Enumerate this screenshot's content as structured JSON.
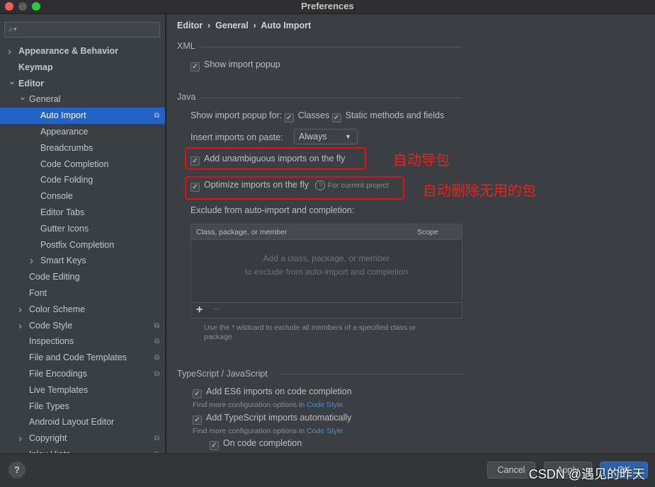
{
  "window": {
    "title": "Preferences"
  },
  "sidebar": {
    "search_placeholder": "",
    "items": [
      {
        "label": "Appearance & Behavior",
        "level": 0,
        "arrow": "right",
        "bold": true
      },
      {
        "label": "Keymap",
        "level": 0,
        "bold": true
      },
      {
        "label": "Editor",
        "level": 0,
        "arrow": "down",
        "bold": true
      },
      {
        "label": "General",
        "level": 1,
        "arrow": "down"
      },
      {
        "label": "Auto Import",
        "level": 2,
        "selected": true,
        "copy_icon": true
      },
      {
        "label": "Appearance",
        "level": 2
      },
      {
        "label": "Breadcrumbs",
        "level": 2
      },
      {
        "label": "Code Completion",
        "level": 2
      },
      {
        "label": "Code Folding",
        "level": 2
      },
      {
        "label": "Console",
        "level": 2
      },
      {
        "label": "Editor Tabs",
        "level": 2
      },
      {
        "label": "Gutter Icons",
        "level": 2
      },
      {
        "label": "Postfix Completion",
        "level": 2
      },
      {
        "label": "Smart Keys",
        "level": 2,
        "arrow": "right"
      },
      {
        "label": "Code Editing",
        "level": 1
      },
      {
        "label": "Font",
        "level": 1
      },
      {
        "label": "Color Scheme",
        "level": 1,
        "arrow": "right"
      },
      {
        "label": "Code Style",
        "level": 1,
        "arrow": "right",
        "copy_icon": true
      },
      {
        "label": "Inspections",
        "level": 1,
        "copy_icon": true
      },
      {
        "label": "File and Code Templates",
        "level": 1,
        "copy_icon": true
      },
      {
        "label": "File Encodings",
        "level": 1,
        "copy_icon": true
      },
      {
        "label": "Live Templates",
        "level": 1
      },
      {
        "label": "File Types",
        "level": 1
      },
      {
        "label": "Android Layout Editor",
        "level": 1
      },
      {
        "label": "Copyright",
        "level": 1,
        "arrow": "right",
        "copy_icon": true
      },
      {
        "label": "Inlay Hints",
        "level": 1,
        "arrow": "right",
        "copy_icon": true
      }
    ]
  },
  "breadcrumb": [
    "Editor",
    "General",
    "Auto Import"
  ],
  "xml": {
    "section": "XML",
    "show_import_popup": {
      "label": "Show import popup",
      "checked": true
    }
  },
  "java": {
    "section": "Java",
    "show_popup_for_label": "Show import popup for:",
    "classes": {
      "label": "Classes",
      "checked": true
    },
    "static": {
      "label": "Static methods and fields",
      "checked": true
    },
    "insert_on_paste_label": "Insert imports on paste:",
    "insert_on_paste_value": "Always",
    "add_unambiguous": {
      "label": "Add unambiguous imports on the fly",
      "checked": true
    },
    "optimize": {
      "label": "Optimize imports on the fly",
      "checked": true,
      "note": "For current project"
    },
    "exclude_label": "Exclude from auto-import and completion:",
    "table": {
      "columns": [
        "Class, package, or member",
        "Scope"
      ],
      "empty_line1": "Add a class, package, or member",
      "empty_line2": "to exclude from auto-import and completion"
    },
    "wildcard_hint": "Use the * wildcard to exclude all members of a specified class or package"
  },
  "annotations": {
    "auto_import": "自动导包",
    "auto_remove": "自动删除无用的包",
    "color": "#e8231a"
  },
  "typescript": {
    "section": "TypeScript / JavaScript",
    "es6": {
      "label": "Add ES6 imports on code completion",
      "checked": true
    },
    "find_more": "Find more configuration options in",
    "code_style_link": "Code Style",
    "ts_auto": {
      "label": "Add TypeScript imports automatically",
      "checked": true
    },
    "on_completion": {
      "label": "On code completion",
      "checked": true
    }
  },
  "footer": {
    "help": "?",
    "cancel": "Cancel",
    "apply": "Apply",
    "ok": "OK"
  },
  "watermark": "CSDN @遇见的昨天"
}
